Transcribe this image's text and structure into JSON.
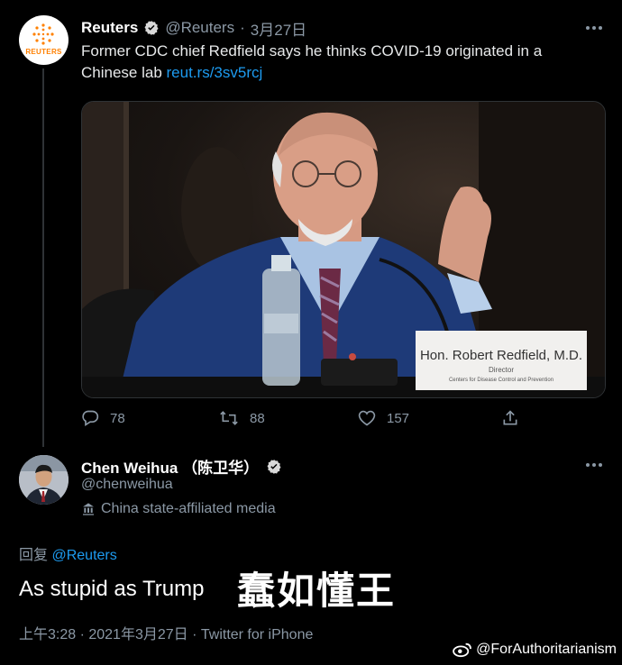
{
  "tweet1": {
    "name": "Reuters",
    "handle": "@Reuters",
    "dot": "·",
    "date": "3月27日",
    "text": "Former CDC chief Redfield says he thinks COVID-19 originated in a Chinese lab",
    "link": "reut.rs/3sv5rcj",
    "avatar_word": "REUTERS",
    "photo": {
      "placard_name": "Hon. Robert Redfield, M.D.",
      "placard_title": "Director",
      "placard_org": "Centers for Disease Control and Prevention"
    },
    "actions": {
      "reply": "78",
      "retweet": "88",
      "like": "157"
    }
  },
  "tweet2": {
    "name": "Chen Weihua （陈卫华）",
    "handle": "@chenweihua",
    "label": "China state-affiliated media",
    "reply_prefix": "回复",
    "reply_target": "@Reuters",
    "text": "As stupid as Trump",
    "meta": "上午3:28 · 2021年3月27日 · Twitter for iPhone"
  },
  "overlay_caption": "蠢如懂王",
  "watermark": "@ForAuthoritarianism",
  "colors": {
    "accent": "#1d9bf0",
    "background": "#000000",
    "dim": "#8b98a5"
  },
  "icons": [
    "verified-badge-icon",
    "more-icon",
    "reply-icon",
    "retweet-icon",
    "like-icon",
    "share-icon",
    "state-media-icon",
    "weibo-icon"
  ]
}
